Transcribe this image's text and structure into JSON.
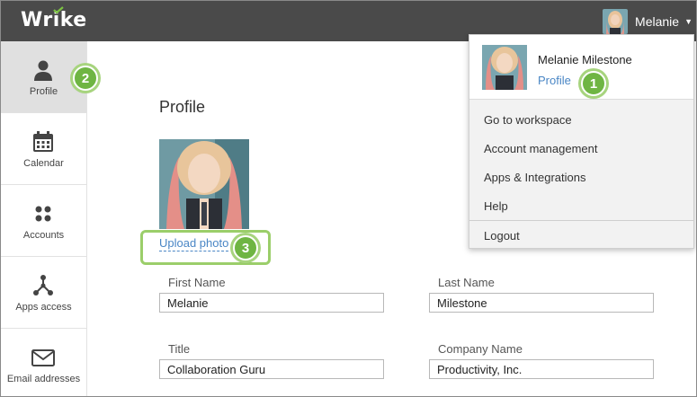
{
  "header": {
    "logo": "Wrike",
    "user_name": "Melanie",
    "caret": "▼"
  },
  "sidebar": {
    "items": [
      {
        "label": "Profile",
        "icon": "person-icon"
      },
      {
        "label": "Calendar",
        "icon": "calendar-icon"
      },
      {
        "label": "Accounts",
        "icon": "grid-dots-icon"
      },
      {
        "label": "Apps access",
        "icon": "network-icon"
      },
      {
        "label": "Email addresses",
        "icon": "envelope-icon"
      }
    ]
  },
  "main": {
    "title": "Profile",
    "upload_photo": "Upload photo",
    "fields": {
      "first_name": {
        "label": "First Name",
        "value": "Melanie"
      },
      "last_name": {
        "label": "Last Name",
        "value": "Milestone"
      },
      "title": {
        "label": "Title",
        "value": "Collaboration Guru"
      },
      "company": {
        "label": "Company Name",
        "value": "Productivity, Inc."
      }
    }
  },
  "dropdown": {
    "full_name": "Melanie Milestone",
    "profile_link": "Profile",
    "items": [
      "Go to workspace",
      "Account management",
      "Apps & Integrations",
      "Help"
    ],
    "logout": "Logout"
  },
  "callouts": {
    "one": "1",
    "two": "2",
    "three": "3"
  },
  "colors": {
    "topbar": "#4a4a4a",
    "accent_green": "#6fb543",
    "link_blue": "#4a86c5"
  }
}
